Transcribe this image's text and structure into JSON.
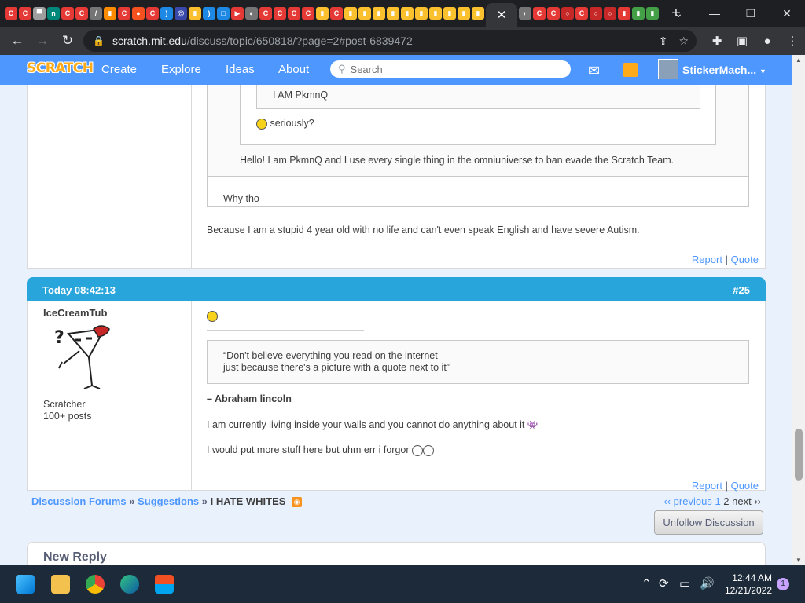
{
  "browser": {
    "url_host": "scratch.mit.edu",
    "url_path": "/discuss/topic/650818/?page=2#post-6839472",
    "colors": {
      "frame": "#1e1f22",
      "toolbar": "#35363a"
    }
  },
  "nav": {
    "logo": "SCRATCH",
    "links": [
      "Create",
      "Explore",
      "Ideas",
      "About"
    ],
    "search_placeholder": "Search",
    "username": "StickerMach...",
    "color": "#4d97ff"
  },
  "post1": {
    "nested_quote_text": "I AM PkmnQ",
    "quote2_text": "seriously?",
    "quote3_text": "Hello! I am PkmnQ and I use every single thing in the omniuniverse to ban evade the Scratch Team.",
    "quote4_text": "Why tho",
    "body": "Because I am a stupid 4 year old with no life and can't even speak English and have severe Autism.",
    "report": "Report",
    "separator": "|",
    "quote": "Quote"
  },
  "post2": {
    "time": "Today 08:42:13",
    "number": "#25",
    "author": "IceCreamTub",
    "role": "Scratcher",
    "posts": "100+ posts",
    "quote_line1": "“Don't believe everything you read on the internet",
    "quote_line2": "just because there's a picture with a quote next to it”",
    "attribution": "– Abraham lincoln",
    "line1": "I am currently living inside your walls and you cannot do anything about it",
    "line2": "I would put more stuff here but uhm err i forgor",
    "report": "Report",
    "separator": "|",
    "quote": "Quote",
    "header_color": "#28a5da"
  },
  "breadcrumb": {
    "forums": "Discussion Forums",
    "sep": "»",
    "suggestions": "Suggestions",
    "topic": "I HATE WHITES"
  },
  "pager": {
    "previous": "‹‹ previous",
    "page1": "1",
    "page2": "2",
    "next": "next ››"
  },
  "unfollow_label": "Unfollow Discussion",
  "new_reply_label": "New Reply",
  "taskbar": {
    "time": "12:44 AM",
    "date": "12/21/2022",
    "notifications": "1"
  }
}
